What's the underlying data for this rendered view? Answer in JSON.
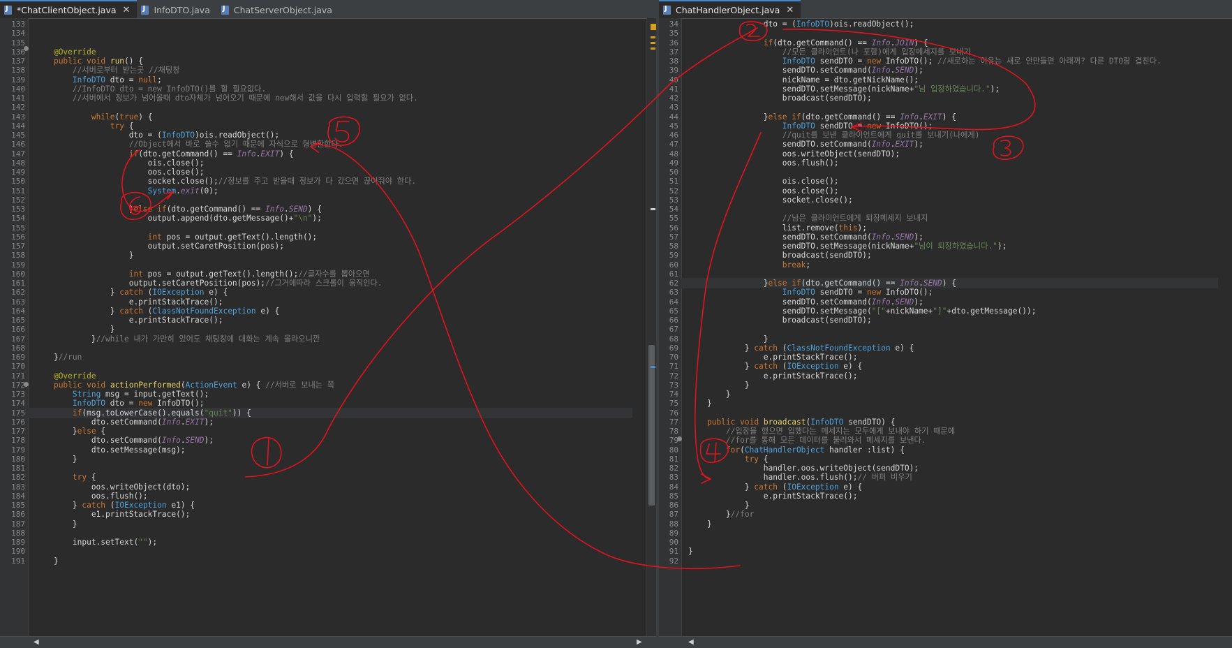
{
  "left_editor": {
    "tabs": [
      {
        "label": "*ChatClientObject.java",
        "active": true,
        "closable": true
      },
      {
        "label": "InfoDTO.java",
        "active": false,
        "closable": false
      },
      {
        "label": "ChatServerObject.java",
        "active": false,
        "closable": false
      }
    ],
    "lines": [
      {
        "n": "133",
        "html": ""
      },
      {
        "n": "134",
        "html": ""
      },
      {
        "n": "135",
        "html": ""
      },
      {
        "n": "136",
        "html": "    <span class='an'>@Override</span>"
      },
      {
        "n": "137",
        "html": "    <span class='kw'>public</span> <span class='kw'>void</span> <span class='fn'>run</span>() {"
      },
      {
        "n": "138",
        "html": "        <span class='cm'>//서버로부터 받는곳 //채팅창</span>"
      },
      {
        "n": "139",
        "html": "        <span class='ty'>InfoDTO</span> dto = <span class='kw'>null</span>;"
      },
      {
        "n": "140",
        "html": "        <span class='cm'>//InfoDTO dto = new InfoDTO()를 할 필요없다.</span>"
      },
      {
        "n": "141",
        "html": "        <span class='cm'>//서버에서 정보가 넘어올때 dto자체가 넘어오기 때문에 new해서 값을 다시 입력할 필요가 없다.</span>"
      },
      {
        "n": "142",
        "html": ""
      },
      {
        "n": "143",
        "html": "            <span class='kw'>while</span>(<span class='kw'>true</span>) {"
      },
      {
        "n": "144",
        "html": "                <span class='kw'>try</span> {"
      },
      {
        "n": "145",
        "html": "                    dto = (<span class='ty'>InfoDTO</span>)ois.readObject();"
      },
      {
        "n": "146",
        "html": "                    <span class='cm'>//Object에서 바로 쓸수 없기 때문에 자식으로 형변환한다.</span>"
      },
      {
        "n": "147",
        "html": "                    <span class='kw'>if</span>(dto.getCommand() == <span class='it'>Info</span>.<span class='it'>EXIT</span>) {"
      },
      {
        "n": "148",
        "html": "                        ois.close();"
      },
      {
        "n": "149",
        "html": "                        oos.close();"
      },
      {
        "n": "150",
        "html": "                        socket.close();<span class='cm'>//정보를 주고 받을때 정보가 다 갔으면 끊어줘야 한다.</span>"
      },
      {
        "n": "151",
        "html": "                        <span class='ty'>System</span>.<span class='it'>exit</span>(0);"
      },
      {
        "n": "152",
        "html": ""
      },
      {
        "n": "153",
        "html": "                    }<span class='kw'>else if</span>(dto.getCommand() == <span class='it'>Info</span>.<span class='it'>SEND</span>) {"
      },
      {
        "n": "154",
        "html": "                        output.append(dto.getMessage()+<span class='st'>\"\\n\"</span>);"
      },
      {
        "n": "155",
        "html": ""
      },
      {
        "n": "156",
        "html": "                        <span class='kw'>int</span> pos = output.getText().length();"
      },
      {
        "n": "157",
        "html": "                        output.setCaretPosition(pos);"
      },
      {
        "n": "158",
        "html": "                    }"
      },
      {
        "n": "159",
        "html": ""
      },
      {
        "n": "160",
        "html": "                    <span class='kw'>int</span> pos = output.getText().length();<span class='cm'>//글자수를 뽑아오면</span>"
      },
      {
        "n": "161",
        "html": "                    output.setCaretPosition(pos);<span class='cm'>//그거에따라 스크롤이 움직인다.</span>"
      },
      {
        "n": "162",
        "html": "                } <span class='kw'>catch</span> (<span class='ty'>IOException</span> e) {"
      },
      {
        "n": "163",
        "html": "                    e.printStackTrace();"
      },
      {
        "n": "164",
        "html": "                } <span class='kw'>catch</span> (<span class='ty'>ClassNotFoundException</span> e) {"
      },
      {
        "n": "165",
        "html": "                    e.printStackTrace();"
      },
      {
        "n": "166",
        "html": "                }"
      },
      {
        "n": "167",
        "html": "            }<span class='cm'>//while 내가 가만히 있어도 채팅창에 대화는 계속 올라오니깐</span>"
      },
      {
        "n": "168",
        "html": ""
      },
      {
        "n": "169",
        "html": "    }<span class='cm'>//run</span>"
      },
      {
        "n": "170",
        "html": ""
      },
      {
        "n": "171",
        "html": "    <span class='an'>@Override</span>"
      },
      {
        "n": "172",
        "html": "    <span class='kw'>public</span> <span class='kw'>void</span> <span class='fn'>actionPerformed</span>(<span class='ty'>ActionEvent</span> e) { <span class='cm'>//서버로 보내는 쪽</span>"
      },
      {
        "n": "173",
        "html": "        <span class='ty'>String</span> msg = input.getText();"
      },
      {
        "n": "174",
        "html": "        <span class='ty'>InfoDTO</span> dto = <span class='kw'>new</span> InfoDTO();"
      },
      {
        "n": "175",
        "html": "        <span class='kw'>if</span>(msg.toLowerCase().equals(<span class='st'>\"quit\"</span>)) {"
      },
      {
        "n": "176",
        "html": "            dto.setCommand(<span class='it'>Info</span>.<span class='it'>EXIT</span>);"
      },
      {
        "n": "177",
        "html": "        }<span class='kw'>else</span> {"
      },
      {
        "n": "178",
        "html": "            dto.setCommand(<span class='it'>Info</span>.<span class='it'>SEND</span>);"
      },
      {
        "n": "179",
        "html": "            dto.setMessage(msg);"
      },
      {
        "n": "180",
        "html": "        }"
      },
      {
        "n": "181",
        "html": ""
      },
      {
        "n": "182",
        "html": "        <span class='kw'>try</span> {"
      },
      {
        "n": "183",
        "html": "            oos.writeObject(dto);"
      },
      {
        "n": "184",
        "html": "            oos.flush();"
      },
      {
        "n": "185",
        "html": "        } <span class='kw'>catch</span> (<span class='ty'>IOException</span> e1) {"
      },
      {
        "n": "186",
        "html": "            e1.printStackTrace();"
      },
      {
        "n": "187",
        "html": "        }"
      },
      {
        "n": "188",
        "html": ""
      },
      {
        "n": "189",
        "html": "        input.setText(<span class='st'>\"\"</span>);"
      },
      {
        "n": "190",
        "html": ""
      },
      {
        "n": "191",
        "html": "    }"
      }
    ]
  },
  "right_editor": {
    "tabs": [
      {
        "label": "ChatHandlerObject.java",
        "active": true,
        "closable": true
      }
    ],
    "lines": [
      {
        "n": "34",
        "html": "                dto = (<span class='ty'>InfoDTO</span>)ois.readObject();"
      },
      {
        "n": "35",
        "html": ""
      },
      {
        "n": "36",
        "html": "                <span class='kw'>if</span>(dto.getCommand() == <span class='it'>Info</span>.<span class='it'>JOIN</span>) {"
      },
      {
        "n": "37",
        "html": "                    <span class='cm'>//모든 클라이언트(나 포함)에게 입장메세지를 보내기</span>"
      },
      {
        "n": "38",
        "html": "                    <span class='ty'>InfoDTO</span> sendDTO = <span class='kw'>new</span> InfoDTO(); <span class='cm'>//새로하는 이유는 새로 안만들면 아래꺼? 다른 DTO랑 겹친다.</span>"
      },
      {
        "n": "39",
        "html": "                    sendDTO.setCommand(<span class='it'>Info</span>.<span class='it'>SEND</span>);"
      },
      {
        "n": "40",
        "html": "                    nickName = dto.getNickName();"
      },
      {
        "n": "41",
        "html": "                    sendDTO.setMessage(nickName+<span class='st'>\"님 입장하였습니다.\"</span>);"
      },
      {
        "n": "42",
        "html": "                    broadcast(sendDTO);"
      },
      {
        "n": "43",
        "html": ""
      },
      {
        "n": "44",
        "html": "                }<span class='kw'>else if</span>(dto.getCommand() == <span class='it'>Info</span>.<span class='it'>EXIT</span>) {"
      },
      {
        "n": "45",
        "html": "                    <span class='ty'>InfoDTO</span> sendDTO = <span class='kw'>new</span> InfoDTO();"
      },
      {
        "n": "46",
        "html": "                    <span class='cm'>//quit를 보낸 클라이언트에게 quit를 보내기(나에게)</span>"
      },
      {
        "n": "47",
        "html": "                    sendDTO.setCommand(<span class='it'>Info</span>.<span class='it'>EXIT</span>);"
      },
      {
        "n": "48",
        "html": "                    oos.writeObject(sendDTO);"
      },
      {
        "n": "49",
        "html": "                    oos.flush();"
      },
      {
        "n": "50",
        "html": ""
      },
      {
        "n": "51",
        "html": "                    ois.close();"
      },
      {
        "n": "52",
        "html": "                    oos.close();"
      },
      {
        "n": "53",
        "html": "                    socket.close();"
      },
      {
        "n": "54",
        "html": ""
      },
      {
        "n": "55",
        "html": "                    <span class='cm'>//남은 클라이언트에게 퇴장메세지 보내지</span>"
      },
      {
        "n": "56",
        "html": "                    list.remove(<span class='kw'>this</span>);"
      },
      {
        "n": "57",
        "html": "                    sendDTO.setCommand(<span class='it'>Info</span>.<span class='it'>SEND</span>);"
      },
      {
        "n": "58",
        "html": "                    sendDTO.setMessage(nickName+<span class='st'>\"님이 퇴장하였습니다.\"</span>);"
      },
      {
        "n": "59",
        "html": "                    broadcast(sendDTO);"
      },
      {
        "n": "60",
        "html": "                    <span class='kw'>break</span>;"
      },
      {
        "n": "61",
        "html": ""
      },
      {
        "n": "62",
        "html": "                }<span class='kw'>else if</span>(dto.getCommand() == <span class='it'>Info</span>.<span class='it'>SEND</span>) {"
      },
      {
        "n": "63",
        "html": "                    <span class='ty'>InfoDTO</span> sendDTO = <span class='kw'>new</span> InfoDTO();"
      },
      {
        "n": "64",
        "html": "                    sendDTO.setCommand(<span class='it'>Info</span>.<span class='it'>SEND</span>);"
      },
      {
        "n": "65",
        "html": "                    sendDTO.setMessage(<span class='st'>\"[\"</span>+nickName+<span class='st'>\"]\"</span>+dto.getMessage());"
      },
      {
        "n": "66",
        "html": "                    broadcast(sendDTO);"
      },
      {
        "n": "67",
        "html": ""
      },
      {
        "n": "68",
        "html": "                }"
      },
      {
        "n": "69",
        "html": "            } <span class='kw'>catch</span> (<span class='ty'>ClassNotFoundException</span> e) {"
      },
      {
        "n": "70",
        "html": "                e.printStackTrace();"
      },
      {
        "n": "71",
        "html": "            } <span class='kw'>catch</span> (<span class='ty'>IOException</span> e) {"
      },
      {
        "n": "72",
        "html": "                e.printStackTrace();"
      },
      {
        "n": "73",
        "html": "            }"
      },
      {
        "n": "74",
        "html": "        }"
      },
      {
        "n": "75",
        "html": "    }"
      },
      {
        "n": "76",
        "html": ""
      },
      {
        "n": "77",
        "html": "    <span class='kw'>public</span> <span class='kw'>void</span> <span class='fn'>broadcast</span>(<span class='ty'>InfoDTO</span> sendDTO) {"
      },
      {
        "n": "78",
        "html": "        <span class='cm'>//입장을 했으면 입했다는 메세지는 모두에게 보내야 하기 때문에</span>"
      },
      {
        "n": "79",
        "html": "        <span class='cm'>//for를 통해 모든 데이터를 불러와서 메세지를 보낸다.</span>"
      },
      {
        "n": "80",
        "html": "        <span class='kw'>for</span>(<span class='ty'>ChatHandlerObject</span> handler :list) {"
      },
      {
        "n": "81",
        "html": "            <span class='kw'>try</span> {"
      },
      {
        "n": "82",
        "html": "                handler.oos.writeObject(sendDTO);"
      },
      {
        "n": "83",
        "html": "                handler.oos.flush();<span class='cm'>// 버퍼 비우기</span>"
      },
      {
        "n": "84",
        "html": "            } <span class='kw'>catch</span> (<span class='ty'>IOException</span> e) {"
      },
      {
        "n": "85",
        "html": "                e.printStackTrace();"
      },
      {
        "n": "86",
        "html": "            }"
      },
      {
        "n": "87",
        "html": "        }<span class='cm'>//for</span>"
      },
      {
        "n": "88",
        "html": "    }"
      },
      {
        "n": "89",
        "html": ""
      },
      {
        "n": "90",
        "html": ""
      },
      {
        "n": "91",
        "html": "}"
      },
      {
        "n": "92",
        "html": ""
      }
    ]
  },
  "annotations": [
    {
      "label": "1"
    },
    {
      "label": "2"
    },
    {
      "label": "3"
    },
    {
      "label": "4"
    },
    {
      "label": "5"
    },
    {
      "label": "6"
    }
  ],
  "colors": {
    "background": "#2b2b2b",
    "annotation": "#e0141e",
    "keyword": "#cc7832",
    "type": "#4fa3dd",
    "comment": "#808080",
    "string": "#6a8759"
  }
}
